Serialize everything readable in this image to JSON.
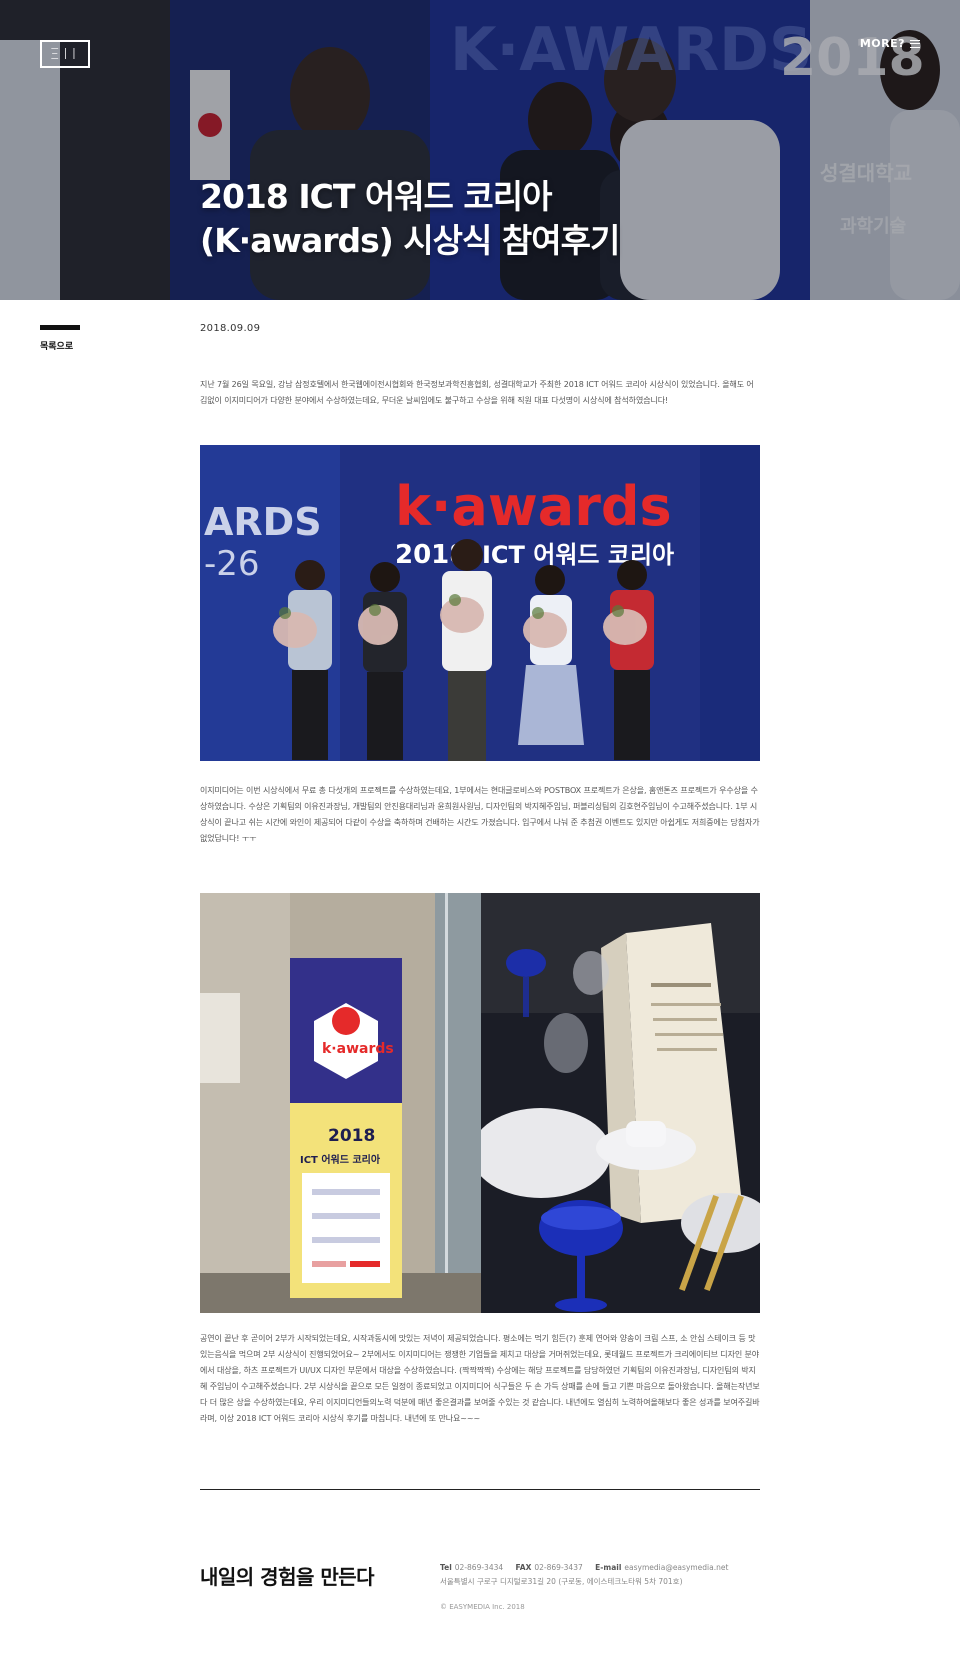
{
  "header": {
    "logo_text": "ΞΙΙ",
    "more_label": "MORE?",
    "title_line1": "2018 ICT 어워드 코리아",
    "title_line2": "(K·awards) 시상식 참여후기"
  },
  "sidebar": {
    "back_label": "목록으로"
  },
  "article": {
    "date": "2018.09.09",
    "paragraph1": "지난 7월 26일 목요일, 강남 삼정호텔에서 한국웹에이전시협회와 한국정보과학진흥협회, 성결대학교가 주최한 2018 ICT 어워드 코리아 시상식이 있었습니다. 올해도 어김없이 이지미디어가 다양한 분야에서 수상하였는데요, 무더운 날씨임에도 불구하고 수상을 위해 직원 대표 다섯명이 시상식에 참석하였습니다!",
    "paragraph2": "이지미디어는 이번 시상식에서 무료 총 다섯개의 프로젝트를 수상하였는데요, 1부에서는 현대글로비스와 POSTBOX 프로젝트가 은상을, 홈앤톤즈 프로젝트가 우수상을 수상하였습니다. 수상은 기획팀의 이유진과장님, 개발팀의 안진용대리님과 윤희원사원님, 디자인팀의 박지혜주임님, 퍼블리싱팀의 김호현주임님이 수고해주셨습니다. 1부 시상식이 끝나고 쉬는 시간에 와인이 제공되어 다같이 수상을 축하하며 건배하는 시간도 가졌습니다. 입구에서 나눠 준 추첨권 이벤트도 있지만 아쉽게도 저희중에는 당첨자가 없었답니다! ㅜㅜ",
    "paragraph3": "공연이 끝난 후 곧이어 2부가 시작되었는데요, 시작과동시에 맛있는 저녁이 제공되었습니다. 평소에는 먹기 힘든(?) 훈제 연어와 양송이 크림 스프, 소 안심 스테이크 등 맛있는음식을 먹으며 2부 시상식이 진행되었어요~ 2부에서도 이지미디어는 쟁쟁한 기업들을 제치고 대상을 거머쥐었는데요, 롯데월드 프로젝트가 크리에이티브 디자인 분야에서 대상을, 하츠 프로젝트가 UI/UX 디자인 부문에서 대상을 수상하였습니다. (짝짝짝짝) 수상에는 해당 프로젝트를 담당하였던 기획팀의 이유진과장님, 디자인팀의 박지혜 주임님이 수고해주셨습니다. 2부 시상식을 끝으로 모든 일정이 종료되었고 이지미디어 식구들은 두 손 가득 상패를 손에 들고 기쁜 마음으로 돌아왔습니다. 올해는작년보다 더 많은 상을 수상하였는데요, 우리 이지미디언들의노력 덕분에 매년 좋은결과를 보여줄 수있는 것 같습니다. 내년에도 열심히 노력하여올해보다 좋은 성과를 보여주길바라며, 이상 2018 ICT 어워드 코리아 시상식 후기를 마칩니다. 내년에 또 만나요~~~",
    "banner_brand": "k·awards",
    "banner_year": "2018",
    "banner_subtitle": "ICT 어워드 코리아",
    "stand_year": "2018",
    "stand_title": "ICT 어워드 코리아",
    "stand_logo": "k·awards"
  },
  "footer": {
    "slogan": "내일의 경험을 만든다",
    "tel_label": "Tel",
    "tel": "02-869-3434",
    "fax_label": "FAX",
    "fax": "02-869-3437",
    "email_label": "E-mail",
    "email": "easymedia@easymedia.net",
    "address": "서울특별시 구로구 디지털로31길 20 (구로동, 에이스테크노타워 5차 701호)",
    "copyright": "© EASYMEDIA Inc. 2018"
  },
  "colors": {
    "accent": "#e52a2a",
    "hero_blue": "#1b2f7a",
    "text_dark": "#111111",
    "text_body": "#555555"
  }
}
